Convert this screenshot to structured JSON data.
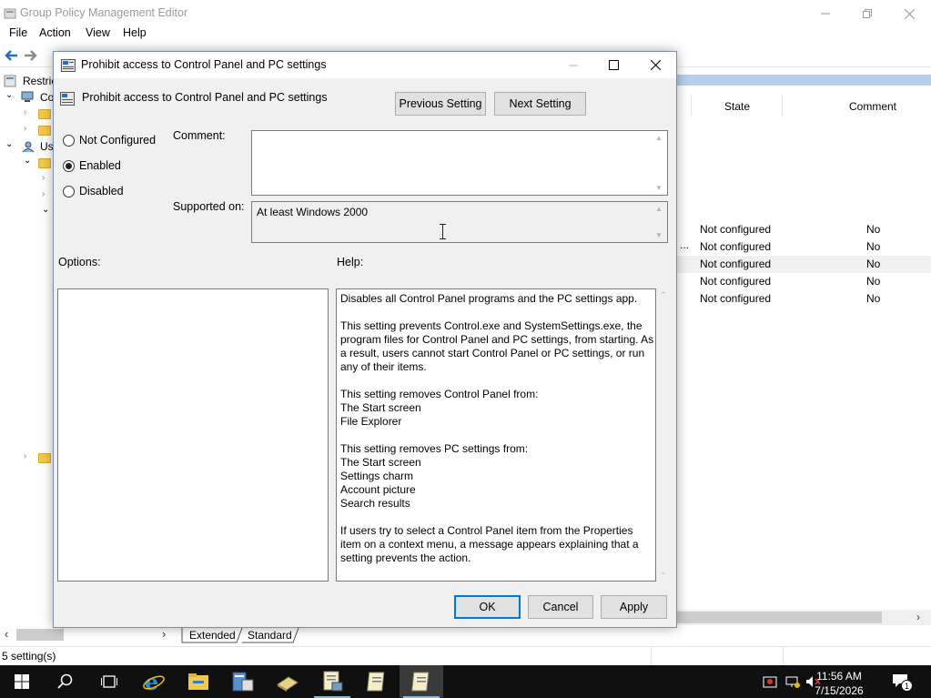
{
  "main_window": {
    "title": "Group Policy Management Editor",
    "menu": [
      "File",
      "Action",
      "View",
      "Help"
    ],
    "tree": {
      "row0": "Restric",
      "row1": "Co",
      "row4": "Us"
    },
    "list": {
      "col_state": "State",
      "col_comment": "Comment",
      "rows": [
        {
          "state": "Not configured",
          "comment": "No"
        },
        {
          "state": "Not configured",
          "comment": "No"
        },
        {
          "state": "Not configured",
          "comment": "No"
        },
        {
          "state": "Not configured",
          "comment": "No"
        },
        {
          "state": "Not configured",
          "comment": "No"
        }
      ],
      "ellipsis": "..."
    },
    "tabs": [
      "Extended",
      "Standard"
    ],
    "status": "5 setting(s)"
  },
  "dialog": {
    "title": "Prohibit access to Control Panel and PC settings",
    "setting_name": "Prohibit access to Control Panel and PC settings",
    "previous_label": "Previous Setting",
    "next_label": "Next Setting",
    "radio": {
      "not_configured": "Not Configured",
      "enabled": "Enabled",
      "disabled": "Disabled",
      "selected": "enabled"
    },
    "comment_label": "Comment:",
    "comment_value": "",
    "supported_label": "Supported on:",
    "supported_value": "At least Windows 2000",
    "options_label": "Options:",
    "help_label": "Help:",
    "help_paragraphs": [
      "Disables all Control Panel programs and the PC settings app.",
      "This setting prevents Control.exe and SystemSettings.exe, the program files for Control Panel and PC settings, from starting. As a result, users cannot start Control Panel or PC settings, or run any of their items.",
      "This setting removes Control Panel from:\nThe Start screen\nFile Explorer",
      "This setting removes PC settings from:\nThe Start screen\nSettings charm\nAccount picture\nSearch results",
      "If users try to select a Control Panel item from the Properties item on a context menu, a message appears explaining that a setting prevents the action."
    ],
    "ok_label": "OK",
    "cancel_label": "Cancel",
    "apply_label": "Apply"
  },
  "taskbar": {
    "time": "11:56 AM",
    "date": "7/15/2026",
    "notification_count": "1",
    "icons": [
      "start-icon",
      "search-icon",
      "task-view-icon",
      "internet-explorer-icon",
      "file-explorer-icon",
      "server-manager-icon",
      "notepad-tools-icon",
      "notepad-icon",
      "notepad-icon",
      "notepad-icon"
    ]
  },
  "colors": {
    "accent": "#0078d7",
    "taskbar_bg": "#101010",
    "dialog_bg": "#f0f0f0",
    "selected_row": "#f0f0f0"
  }
}
